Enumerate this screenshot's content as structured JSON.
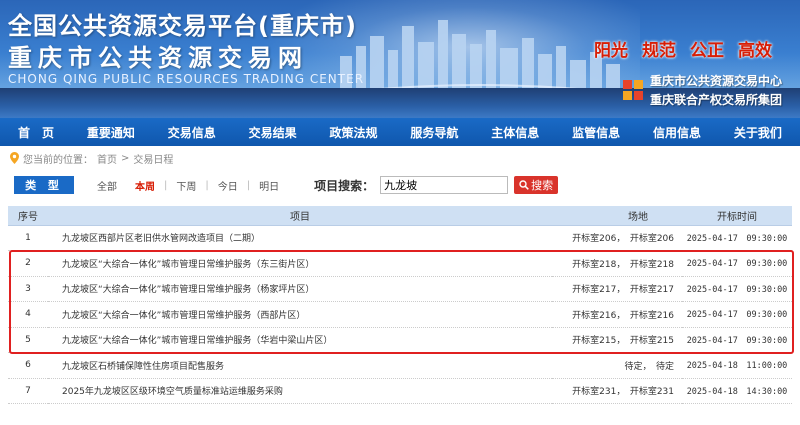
{
  "banner": {
    "title_line1": "全国公共资源交易平台(重庆市)",
    "title_line2": "重庆市公共资源交易网",
    "title_en": "CHONG QING PUBLIC RESOURCES TRADING CENTER",
    "slogans": [
      "阳光",
      "规范",
      "公正",
      "高效"
    ],
    "org_names": [
      "重庆市公共资源交易中心",
      "重庆联合产权交易所集团"
    ]
  },
  "nav": {
    "items": [
      "首　页",
      "重要通知",
      "交易信息",
      "交易结果",
      "政策法规",
      "服务导航",
      "主体信息",
      "监管信息",
      "信用信息",
      "关于我们"
    ]
  },
  "breadcrumb": {
    "prefix": "您当前的位置：",
    "home": "首页",
    "sep": ">",
    "current": "交易日程"
  },
  "filter": {
    "type_label": "类 型",
    "options": [
      {
        "label": "全部",
        "active": false
      },
      {
        "label": "本周",
        "active": true
      },
      {
        "label": "下周",
        "active": false
      },
      {
        "label": "今日",
        "active": false
      },
      {
        "label": "明日",
        "active": false
      }
    ],
    "search_label": "项目搜索：",
    "search_value": "九龙坡",
    "search_button": "搜索"
  },
  "table": {
    "headers": [
      "序号",
      "项目",
      "场地",
      "开标时间"
    ],
    "rows": [
      {
        "idx": "1",
        "project": "九龙坡区西部片区老旧供水管网改造项目（二期）",
        "venue": "开标室206，　开标室206",
        "time": "2025-04-17　09:30:00"
      },
      {
        "idx": "2",
        "project": "九龙坡区“大综合一体化”城市管理日常维护服务（东三街片区）",
        "venue": "开标室218，　开标室218",
        "time": "2025-04-17　09:30:00"
      },
      {
        "idx": "3",
        "project": "九龙坡区“大综合一体化”城市管理日常维护服务（杨家坪片区）",
        "venue": "开标室217，　开标室217",
        "time": "2025-04-17　09:30:00"
      },
      {
        "idx": "4",
        "project": "九龙坡区“大综合一体化”城市管理日常维护服务（西部片区）",
        "venue": "开标室216，　开标室216",
        "time": "2025-04-17　09:30:00"
      },
      {
        "idx": "5",
        "project": "九龙坡区“大综合一体化”城市管理日常维护服务（华岩中梁山片区）",
        "venue": "开标室215，　开标室215",
        "time": "2025-04-17　09:30:00"
      },
      {
        "idx": "6",
        "project": "九龙坡区石桥铺保障性住房项目配售服务",
        "venue": "待定，　待定",
        "time": "2025-04-18　11:00:00"
      },
      {
        "idx": "7",
        "project": "2025年九龙坡区区级环境空气质量标准站运维服务采购",
        "venue": "开标室231，　开标室231",
        "time": "2025-04-18　14:30:00"
      }
    ]
  },
  "colors": {
    "nav_bg": "#1a6ac6",
    "header_row_bg": "#cfe0f3",
    "accent_red": "#d81e06",
    "highlight_border": "#e02020"
  },
  "icons": [
    "location-pin-icon",
    "search-icon",
    "org-logo-icon"
  ]
}
